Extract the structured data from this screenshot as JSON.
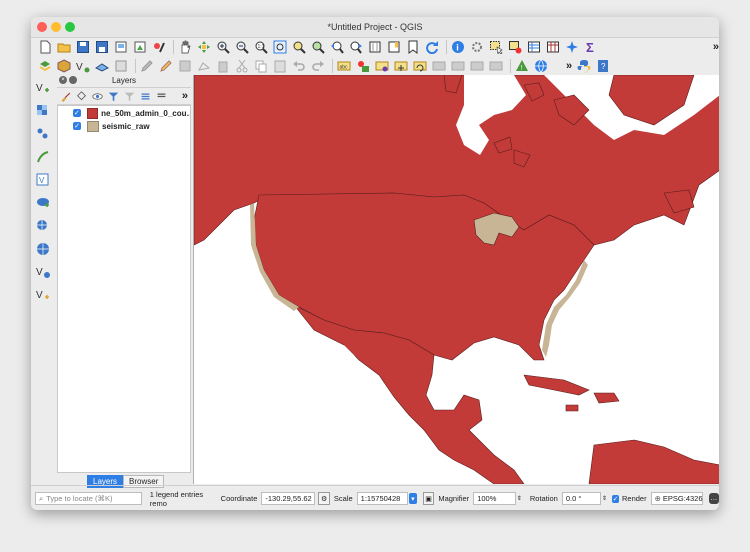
{
  "window": {
    "title": "*Untitled Project - QGIS"
  },
  "colors": {
    "country_fill": "#c23b39",
    "seismic_fill": "#c8b596",
    "accent": "#2f7ee6"
  },
  "toolbar1_icons": [
    "new-project-icon",
    "open-project-icon",
    "save-project-icon",
    "save-as-icon",
    "print-layout-icon",
    "layout-manager-icon",
    "style-manager-icon",
    "pan-icon",
    "pan-to-selection-icon",
    "zoom-in-icon",
    "zoom-out-icon",
    "zoom-native-icon",
    "zoom-full-icon",
    "zoom-to-selection-icon",
    "zoom-to-layer-icon",
    "zoom-last-icon",
    "zoom-next-icon",
    "new-map-view-icon",
    "new-bookmark-icon",
    "show-bookmarks-icon",
    "refresh-icon",
    "identify-icon",
    "action-icon",
    "select-icon",
    "deselect-icon",
    "attribute-table-icon",
    "field-calc-icon",
    "statistics-icon",
    "sum-icon"
  ],
  "toolbar2_icons": [
    "data-source-manager-icon",
    "new-geopackage-icon",
    "new-shapefile-icon",
    "new-spatialite-icon",
    "current-edits-icon",
    "toggle-editing-icon",
    "save-edits-icon",
    "digitize-icon",
    "vertex-tool-icon",
    "delete-icon",
    "cut-icon",
    "copy-icon",
    "paste-icon",
    "undo-icon",
    "redo-icon",
    "label-icon",
    "label-pin-icon",
    "label-show-icon",
    "label-move-icon",
    "label-rotate-icon",
    "label-change-icon",
    "label-options-icon",
    "label-toolbar-icon",
    "label-toolbar2-icon",
    "plugin-icon",
    "python-icon",
    "help-icon"
  ],
  "vertical_tools": [
    "add-vector-layer-icon",
    "add-raster-layer-icon",
    "add-delimited-layer-icon",
    "add-spatialite-icon",
    "add-virtual-layer-icon",
    "add-postgis-icon",
    "add-wms-icon",
    "add-wcs-icon",
    "add-wfs-icon",
    "new-vector-layer-icon"
  ],
  "layers_panel": {
    "title": "Layers",
    "layers": [
      {
        "name": "ne_50m_admin_0_cou…",
        "checked": true,
        "color": "#c23b39"
      },
      {
        "name": "seismic_raw",
        "checked": true,
        "color": "#c8b596"
      }
    ],
    "tabs": [
      "Layers",
      "Browser"
    ]
  },
  "status": {
    "locate_placeholder": "Type to locate (⌘K)",
    "legend_msg": "1 legend entries remo",
    "coordinate_label": "Coordinate",
    "coordinate_value": "-130.29,55.62",
    "scale_label": "Scale",
    "scale_value": "1:15750428",
    "magnifier_label": "Magnifier",
    "magnifier_value": "100%",
    "rotation_label": "Rotation",
    "rotation_value": "0.0 °",
    "render_label": "Render",
    "crs_label": "EPSG:4326"
  }
}
